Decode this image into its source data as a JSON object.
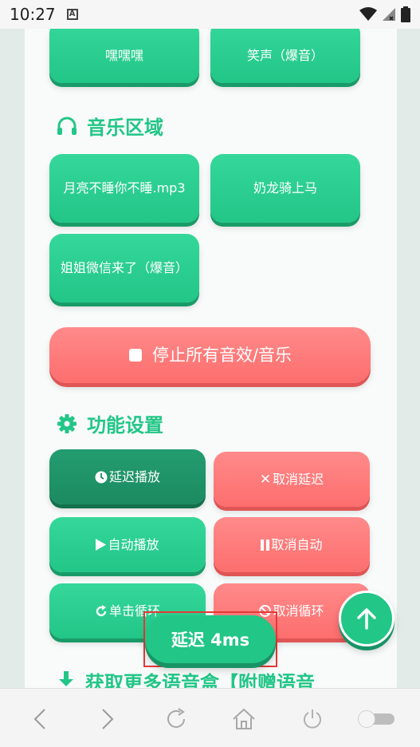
{
  "status_bar": {
    "time": "10:27",
    "notif": "A"
  },
  "top_buttons": {
    "heiheihei": "嘿嘿嘿",
    "xiaosheng": "笑声（爆音）"
  },
  "music_section": {
    "title": "音乐区域",
    "buttons": [
      "月亮不睡你不睡.mp3",
      "奶龙骑上马",
      "姐姐微信来了（爆音）"
    ]
  },
  "stop_all": {
    "label": "停止所有音效/音乐"
  },
  "function_section": {
    "title": "功能设置",
    "delay_play": "延迟播放",
    "cancel_delay": "取消延迟",
    "auto_play": "自动播放",
    "cancel_auto": "取消自动",
    "single_loop": "单击循环",
    "cancel_loop": "取消循环"
  },
  "download_section": {
    "title": "获取更多语音盒【附赠语音"
  },
  "toast": {
    "label": "延迟 4ms"
  },
  "colors": {
    "green": "#22c687",
    "red": "#fd6e6e",
    "dark_green": "#1c8a60"
  }
}
